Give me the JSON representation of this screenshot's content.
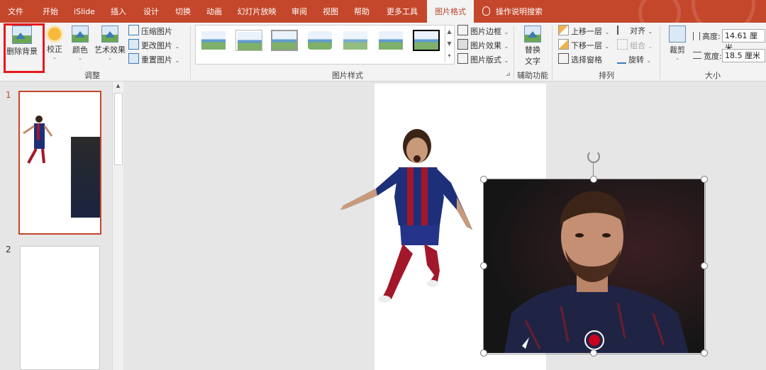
{
  "tabs": [
    "文件",
    "开始",
    "iSlide",
    "插入",
    "设计",
    "切换",
    "动画",
    "幻灯片放映",
    "审阅",
    "视图",
    "帮助",
    "更多工具",
    "图片格式"
  ],
  "tell_me": "操作说明搜索",
  "adjust": {
    "remove_bg": "删除背景",
    "corrections": "校正",
    "color": "颜色",
    "artistic": "艺术效果",
    "compress": "压缩图片",
    "change": "更改图片",
    "reset": "重置图片",
    "group_label": "调整"
  },
  "styles": {
    "border": "图片边框",
    "effects": "图片效果",
    "layout": "图片版式",
    "group_label": "图片样式"
  },
  "accessibility": {
    "alt_text": [
      "替换",
      "文字"
    ],
    "group_label": "辅助功能"
  },
  "arrange": {
    "bring_forward": "上移一层",
    "send_backward": "下移一层",
    "selection_pane": "选择窗格",
    "align": "对齐",
    "group": "组合",
    "rotate": "旋转",
    "group_label": "排列"
  },
  "size": {
    "crop": "裁剪",
    "height_label": "高度:",
    "height_value": "14.61 厘米",
    "width_label": "宽度:",
    "width_value": "18.5 厘米",
    "group_label": "大小"
  },
  "slides": [
    {
      "number": "1"
    },
    {
      "number": "2"
    }
  ],
  "colors": {
    "accent": "#c4472b",
    "highlight": "#e8161c"
  }
}
